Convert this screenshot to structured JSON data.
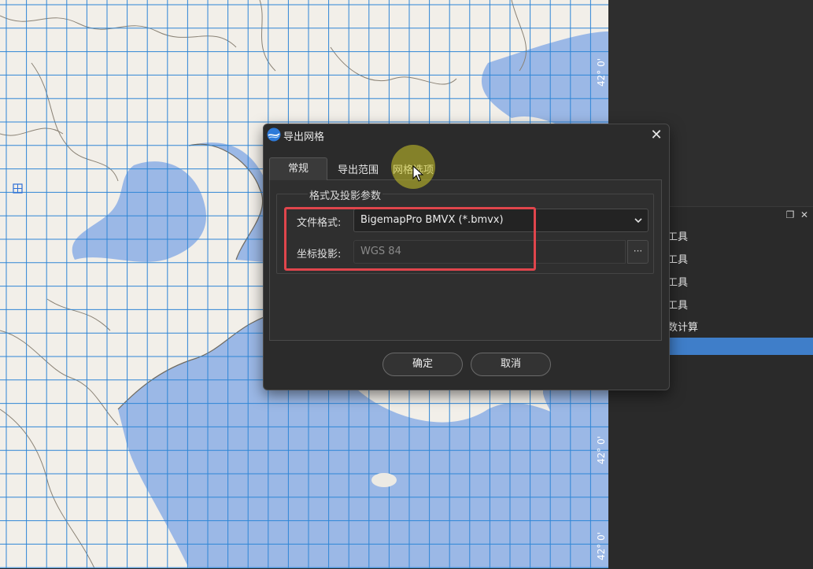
{
  "map": {
    "coord_labels": [
      "42° 0'",
      "42° 0'",
      "42° 0'"
    ]
  },
  "tool_panel": {
    "items": [
      "工具",
      "工具",
      "工具",
      "工具",
      "数计算"
    ]
  },
  "dialog": {
    "title": "导出网格",
    "tabs": [
      "常规",
      "导出范围",
      "网格选项"
    ],
    "group_title": "格式及投影参数",
    "format_label": "文件格式:",
    "format_value": "BigemapPro BMVX (*.bmvx)",
    "projection_label": "坐标投影:",
    "projection_value": "WGS 84",
    "browse_label": "···",
    "ok_label": "确定",
    "cancel_label": "取消"
  },
  "colors": {
    "sea": "#9bb8e6",
    "land": "#f2efe9",
    "grid": "#2f86d6",
    "accent_blue": "#3f7ec9",
    "highlight": "#e0454c"
  }
}
